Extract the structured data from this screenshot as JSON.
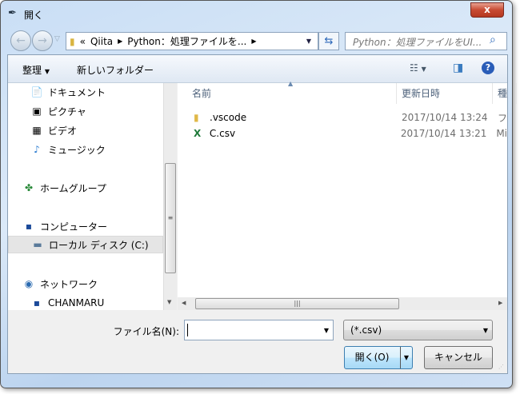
{
  "window": {
    "title": "開く"
  },
  "nav": {
    "breadcrumb": [
      "Qiita",
      "Python：処理ファイルを..."
    ],
    "search_placeholder": "Python：処理ファイルをUI..."
  },
  "toolbar": {
    "organize": "整理",
    "new_folder": "新しいフォルダー"
  },
  "sidebar": {
    "items": [
      {
        "label": "ドキュメント",
        "icon": "document-icon"
      },
      {
        "label": "ピクチャ",
        "icon": "picture-icon"
      },
      {
        "label": "ビデオ",
        "icon": "video-icon"
      },
      {
        "label": "ミュージック",
        "icon": "music-icon"
      },
      {
        "label": "ホームグループ",
        "icon": "homegroup-icon"
      },
      {
        "label": "コンピューター",
        "icon": "computer-icon"
      },
      {
        "label": "ローカル ディスク (C:)",
        "icon": "disk-icon",
        "selected": true
      },
      {
        "label": "ネットワーク",
        "icon": "network-icon"
      },
      {
        "label": "CHANMARU",
        "icon": "pc-icon"
      }
    ]
  },
  "files": {
    "columns": [
      "名前",
      "更新日時",
      "種"
    ],
    "rows": [
      {
        "name": ".vscode",
        "date": "2017/10/14 13:24",
        "type": "フ"
      },
      {
        "name": "C.csv",
        "date": "2017/10/14 13:21",
        "type": "Mi"
      }
    ]
  },
  "bottom": {
    "filename_label": "ファイル名(N):",
    "filename_value": "",
    "filter": "(*.csv)",
    "open": "開く(O)",
    "cancel": "キャンセル"
  }
}
